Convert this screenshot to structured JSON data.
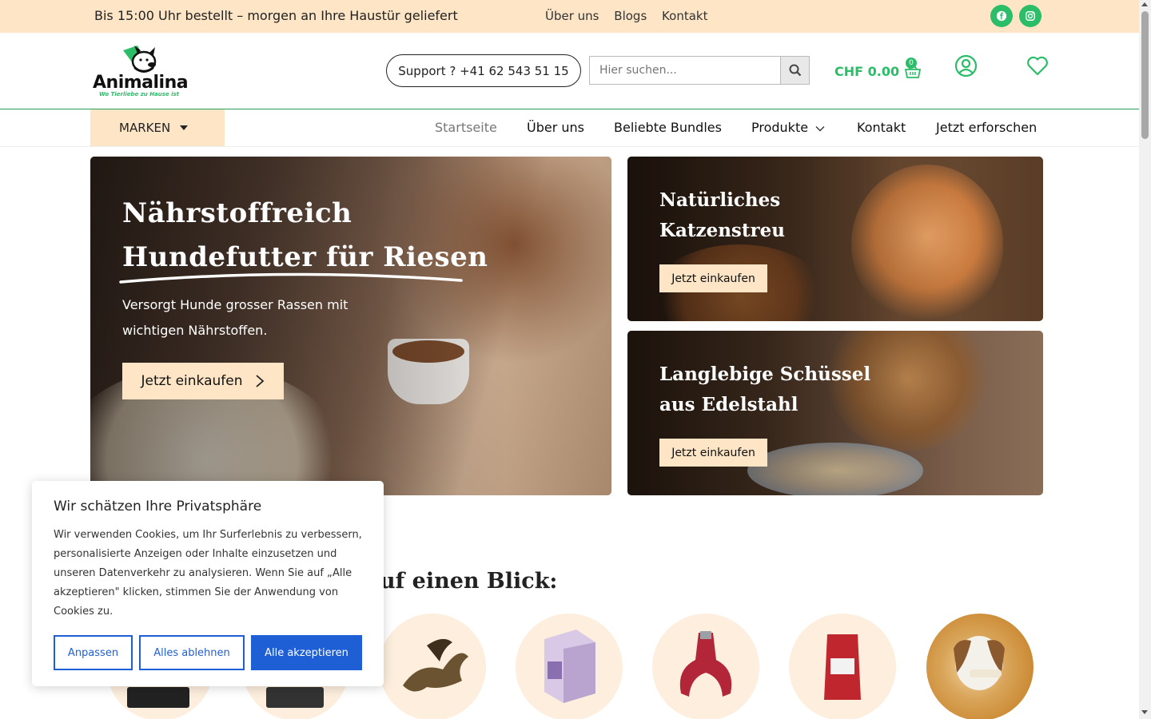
{
  "topbar": {
    "promo": "Bis 15:00 Uhr bestellt – morgen an Ihre Haustür geliefert",
    "links": [
      "Über uns",
      "Blogs",
      "Kontakt"
    ],
    "social_icons": [
      "facebook-icon",
      "instagram-icon"
    ],
    "bg_color": "#fde5c6"
  },
  "header": {
    "logo_text": "Animalina",
    "logo_tagline": "Wo Tierliebe zu Hause ist",
    "support_label": "Support ? +41 62 543 51 15",
    "search_placeholder": "Hier suchen...",
    "cart_total": "CHF 0.00",
    "cart_count": "0",
    "accent_color": "#2bbd68"
  },
  "nav": {
    "brands_label": "MARKEN",
    "items": [
      "Startseite",
      "Über uns",
      "Beliebte Bundles",
      "Produkte",
      "Kontakt",
      "Jetzt erforschen"
    ],
    "active_item": "Startseite"
  },
  "hero": {
    "title_line1": "Nährstoffreich",
    "title_line2": "Hundefutter für Riesen",
    "subtitle": "Versorgt Hunde grosser Rassen mit wichtigen Nährstoffen.",
    "cta": "Jetzt einkaufen"
  },
  "banners": [
    {
      "title_line1": "Natürliches",
      "title_line2": "Katzenstreu",
      "cta": "Jetzt einkaufen"
    },
    {
      "title_line1": "Langlebige Schüssel",
      "title_line2": "aus Edelstahl",
      "cta": "Jetzt einkaufen"
    }
  ],
  "categories": {
    "title": "uf einen Blick:"
  },
  "cookie": {
    "title": "Wir schätzen Ihre Privatsphäre",
    "text": "Wir verwenden Cookies, um Ihr Surferlebnis zu verbessern, personalisierte Anzeigen oder Inhalte einzusetzen und unseren Datenverkehr zu analysieren. Wenn Sie auf „Alle akzeptieren\" klicken, stimmen Sie der Anwendung von Cookies zu.",
    "btn_customize": "Anpassen",
    "btn_reject": "Alles ablehnen",
    "btn_accept": "Alle akzeptieren",
    "button_color": "#1f5fd6"
  }
}
